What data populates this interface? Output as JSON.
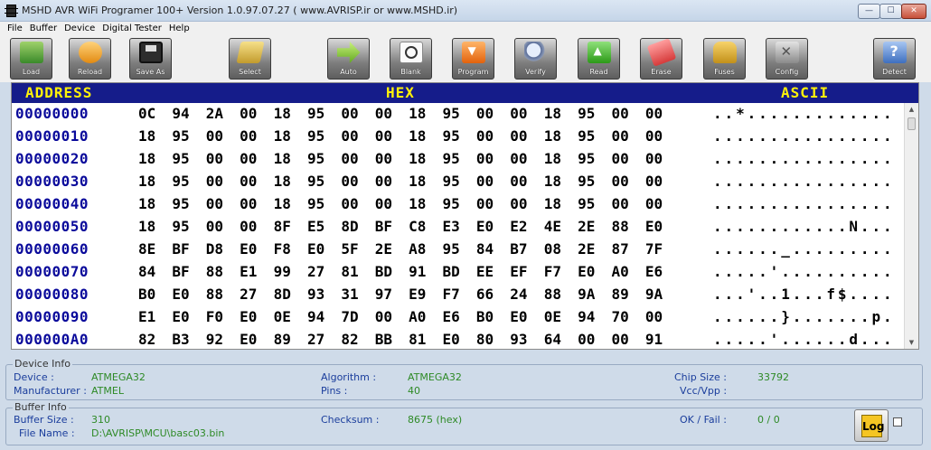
{
  "window": {
    "title": "MSHD AVR WiFi Programer 100+ Version 1.0.97.07.27 ( www.AVRISP.ir or www.MSHD.ir)",
    "controls": {
      "minimize": "—",
      "maximize": "☐",
      "close": "✕"
    }
  },
  "menu": [
    "File",
    "Buffer",
    "Device",
    "Digital Tester",
    "Help"
  ],
  "toolbar": [
    {
      "label": "Load",
      "icon": "folder-open-icon"
    },
    {
      "label": "Reload",
      "icon": "reload-icon"
    },
    {
      "label": "Save As",
      "icon": "floppy-disk-icon"
    },
    {
      "label": "Select",
      "icon": "chip-select-icon"
    },
    {
      "label": "Auto",
      "icon": "arrow-right-icon"
    },
    {
      "label": "Blank",
      "icon": "magnifier-blank-icon"
    },
    {
      "label": "Program",
      "icon": "download-arrow-icon"
    },
    {
      "label": "Verify",
      "icon": "verify-magnifier-icon"
    },
    {
      "label": "Read",
      "icon": "upload-arrow-icon"
    },
    {
      "label": "Erase",
      "icon": "eraser-icon"
    },
    {
      "label": "Fuses",
      "icon": "padlock-icon"
    },
    {
      "label": "Config",
      "icon": "tools-icon"
    },
    {
      "label": "Detect",
      "icon": "help-detect-icon"
    }
  ],
  "hex_view": {
    "headers": {
      "address": "ADDRESS",
      "hex": "HEX",
      "ascii": "ASCII"
    },
    "rows": [
      {
        "address": "00000000",
        "bytes": [
          "0C",
          "94",
          "2A",
          "00",
          "18",
          "95",
          "00",
          "00",
          "18",
          "95",
          "00",
          "00",
          "18",
          "95",
          "00",
          "00"
        ],
        "ascii": "..*............."
      },
      {
        "address": "00000010",
        "bytes": [
          "18",
          "95",
          "00",
          "00",
          "18",
          "95",
          "00",
          "00",
          "18",
          "95",
          "00",
          "00",
          "18",
          "95",
          "00",
          "00"
        ],
        "ascii": "................"
      },
      {
        "address": "00000020",
        "bytes": [
          "18",
          "95",
          "00",
          "00",
          "18",
          "95",
          "00",
          "00",
          "18",
          "95",
          "00",
          "00",
          "18",
          "95",
          "00",
          "00"
        ],
        "ascii": "................"
      },
      {
        "address": "00000030",
        "bytes": [
          "18",
          "95",
          "00",
          "00",
          "18",
          "95",
          "00",
          "00",
          "18",
          "95",
          "00",
          "00",
          "18",
          "95",
          "00",
          "00"
        ],
        "ascii": "................"
      },
      {
        "address": "00000040",
        "bytes": [
          "18",
          "95",
          "00",
          "00",
          "18",
          "95",
          "00",
          "00",
          "18",
          "95",
          "00",
          "00",
          "18",
          "95",
          "00",
          "00"
        ],
        "ascii": "................"
      },
      {
        "address": "00000050",
        "bytes": [
          "18",
          "95",
          "00",
          "00",
          "8F",
          "E5",
          "8D",
          "BF",
          "C8",
          "E3",
          "E0",
          "E2",
          "4E",
          "2E",
          "88",
          "E0"
        ],
        "ascii": "............N..."
      },
      {
        "address": "00000060",
        "bytes": [
          "8E",
          "BF",
          "D8",
          "E0",
          "F8",
          "E0",
          "5F",
          "2E",
          "A8",
          "95",
          "84",
          "B7",
          "08",
          "2E",
          "87",
          "7F"
        ],
        "ascii": "......_........."
      },
      {
        "address": "00000070",
        "bytes": [
          "84",
          "BF",
          "88",
          "E1",
          "99",
          "27",
          "81",
          "BD",
          "91",
          "BD",
          "EE",
          "EF",
          "F7",
          "E0",
          "A0",
          "E6"
        ],
        "ascii": ".....'.........."
      },
      {
        "address": "00000080",
        "bytes": [
          "B0",
          "E0",
          "88",
          "27",
          "8D",
          "93",
          "31",
          "97",
          "E9",
          "F7",
          "66",
          "24",
          "88",
          "9A",
          "89",
          "9A"
        ],
        "ascii": "...'..1...f$...."
      },
      {
        "address": "00000090",
        "bytes": [
          "E1",
          "E0",
          "F0",
          "E0",
          "0E",
          "94",
          "7D",
          "00",
          "A0",
          "E6",
          "B0",
          "E0",
          "0E",
          "94",
          "70",
          "00"
        ],
        "ascii": "......}.......p."
      },
      {
        "address": "000000A0",
        "bytes": [
          "82",
          "B3",
          "92",
          "E0",
          "89",
          "27",
          "82",
          "BB",
          "81",
          "E0",
          "80",
          "93",
          "64",
          "00",
          "00",
          "91"
        ],
        "ascii": ".....'......d..."
      }
    ]
  },
  "device_info": {
    "title": "Device Info",
    "device_label": "Device :",
    "device": "ATMEGA32",
    "manufacturer_label": "Manufacturer :",
    "manufacturer": "ATMEL",
    "algorithm_label": "Algorithm :",
    "algorithm": "ATMEGA32",
    "pins_label": "Pins :",
    "pins": "40",
    "chip_size_label": "Chip Size :",
    "chip_size": "33792",
    "vcc_label": "Vcc/Vpp :",
    "vcc": ""
  },
  "buffer_info": {
    "title": "Buffer Info",
    "buffer_size_label": "Buffer Size :",
    "buffer_size": "310",
    "file_name_label": "File Name :",
    "file_name": "D:\\AVRISP\\MCU\\basc03.bin",
    "checksum_label": "Checksum :",
    "checksum": "8675 (hex)",
    "ok_fail_label": "OK / Fail :",
    "ok_fail": "0 / 0",
    "log_label": "Log"
  },
  "colors": {
    "header_bg": "#151c8a",
    "header_text": "#fff20a",
    "address_text": "#0a0a9b",
    "info_label": "#1a3d9c",
    "info_value": "#2e8a26"
  }
}
